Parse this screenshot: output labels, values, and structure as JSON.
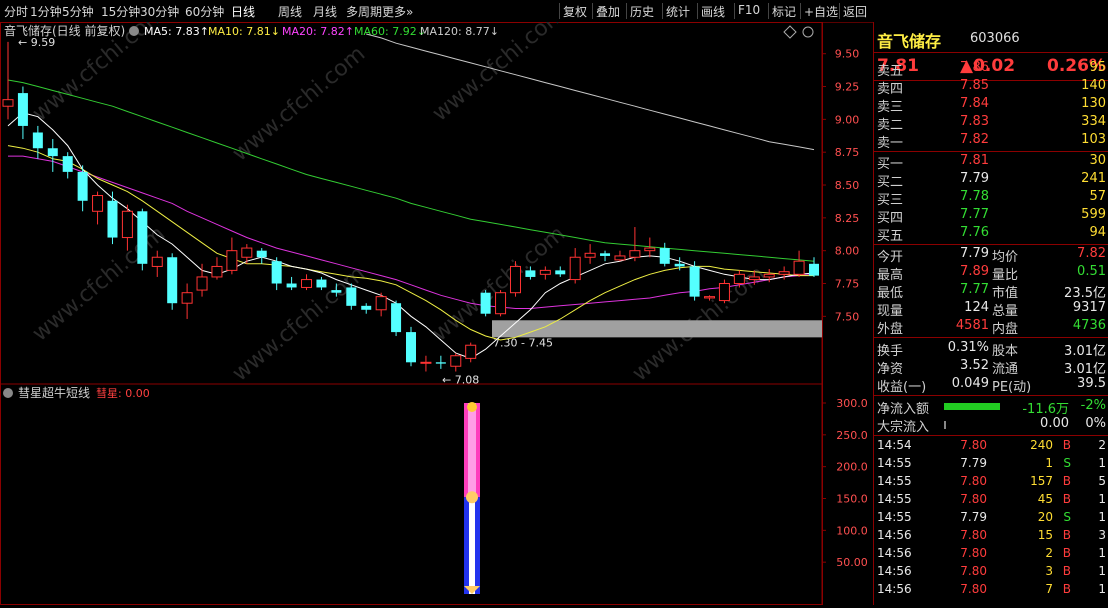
{
  "toolbar": {
    "tabs": [
      "分时",
      "1分钟",
      "5分钟",
      "15分钟",
      "30分钟",
      "60分钟",
      "日线",
      "周线",
      "月线",
      "多周期",
      "更多»"
    ],
    "active": "日线",
    "right_buttons": [
      "复权",
      "叠加",
      "历史",
      "统计",
      "画线",
      "F10",
      "标记",
      "+自选",
      "返回"
    ]
  },
  "main_chart": {
    "title": "音飞储存(日线 前复权)",
    "ma_labels": [
      {
        "text": "MA5: 7.83↑",
        "color": "#ffffff"
      },
      {
        "text": "MA10: 7.81↓",
        "color": "#ffee44"
      },
      {
        "text": "MA20: 7.82↑",
        "color": "#ff44ff"
      },
      {
        "text": "MA60: 7.92↓",
        "color": "#33dd33"
      },
      {
        "text": "MA120: 8.77↓",
        "color": "#cccccc"
      }
    ],
    "high_mark": "9.59",
    "low_mark": "7.08",
    "range_label": "7.30 - 7.45",
    "y_ticks": [
      "9.50",
      "9.25",
      "9.00",
      "8.75",
      "8.50",
      "8.25",
      "8.00",
      "7.75",
      "7.50"
    ]
  },
  "sub_chart": {
    "title": "彗星超牛短线",
    "indicator": "彗星: 0.00",
    "y_ticks": [
      "300.0",
      "250.0",
      "200.0",
      "150.0",
      "100.0",
      "50.00"
    ]
  },
  "chart_data": {
    "type": "candlestick",
    "y_range": [
      7.0,
      9.65
    ],
    "candles": [
      {
        "o": 9.1,
        "h": 9.59,
        "l": 9.0,
        "c": 9.15
      },
      {
        "o": 9.2,
        "h": 9.25,
        "l": 8.85,
        "c": 8.95
      },
      {
        "o": 8.9,
        "h": 8.95,
        "l": 8.7,
        "c": 8.78
      },
      {
        "o": 8.78,
        "h": 8.85,
        "l": 8.6,
        "c": 8.72
      },
      {
        "o": 8.72,
        "h": 8.75,
        "l": 8.55,
        "c": 8.6
      },
      {
        "o": 8.6,
        "h": 8.65,
        "l": 8.3,
        "c": 8.38
      },
      {
        "o": 8.3,
        "h": 8.45,
        "l": 8.2,
        "c": 8.42
      },
      {
        "o": 8.38,
        "h": 8.45,
        "l": 8.05,
        "c": 8.1
      },
      {
        "o": 8.1,
        "h": 8.35,
        "l": 8.0,
        "c": 8.3
      },
      {
        "o": 8.3,
        "h": 8.32,
        "l": 7.85,
        "c": 7.9
      },
      {
        "o": 7.88,
        "h": 8.0,
        "l": 7.8,
        "c": 7.95
      },
      {
        "o": 7.95,
        "h": 7.98,
        "l": 7.55,
        "c": 7.6
      },
      {
        "o": 7.6,
        "h": 7.75,
        "l": 7.48,
        "c": 7.68
      },
      {
        "o": 7.7,
        "h": 7.9,
        "l": 7.65,
        "c": 7.8
      },
      {
        "o": 7.8,
        "h": 7.95,
        "l": 7.78,
        "c": 7.88
      },
      {
        "o": 7.85,
        "h": 8.1,
        "l": 7.82,
        "c": 8.0
      },
      {
        "o": 7.95,
        "h": 8.05,
        "l": 7.9,
        "c": 8.02
      },
      {
        "o": 8.0,
        "h": 8.02,
        "l": 7.9,
        "c": 7.95
      },
      {
        "o": 7.92,
        "h": 7.95,
        "l": 7.7,
        "c": 7.75
      },
      {
        "o": 7.75,
        "h": 7.8,
        "l": 7.7,
        "c": 7.72
      },
      {
        "o": 7.72,
        "h": 7.82,
        "l": 7.7,
        "c": 7.78
      },
      {
        "o": 7.78,
        "h": 7.8,
        "l": 7.7,
        "c": 7.72
      },
      {
        "o": 7.7,
        "h": 7.75,
        "l": 7.65,
        "c": 7.68
      },
      {
        "o": 7.72,
        "h": 7.75,
        "l": 7.55,
        "c": 7.58
      },
      {
        "o": 7.58,
        "h": 7.6,
        "l": 7.52,
        "c": 7.55
      },
      {
        "o": 7.55,
        "h": 7.68,
        "l": 7.5,
        "c": 7.65
      },
      {
        "o": 7.6,
        "h": 7.62,
        "l": 7.35,
        "c": 7.38
      },
      {
        "o": 7.38,
        "h": 7.42,
        "l": 7.12,
        "c": 7.15
      },
      {
        "o": 7.15,
        "h": 7.2,
        "l": 7.08,
        "c": 7.15
      },
      {
        "o": 7.15,
        "h": 7.2,
        "l": 7.1,
        "c": 7.14
      },
      {
        "o": 7.12,
        "h": 7.22,
        "l": 7.08,
        "c": 7.2
      },
      {
        "o": 7.18,
        "h": 7.3,
        "l": 7.15,
        "c": 7.28
      },
      {
        "o": 7.68,
        "h": 7.7,
        "l": 7.5,
        "c": 7.52
      },
      {
        "o": 7.52,
        "h": 7.7,
        "l": 7.5,
        "c": 7.68
      },
      {
        "o": 7.68,
        "h": 7.92,
        "l": 7.65,
        "c": 7.88
      },
      {
        "o": 7.85,
        "h": 7.88,
        "l": 7.78,
        "c": 7.8
      },
      {
        "o": 7.82,
        "h": 7.88,
        "l": 7.78,
        "c": 7.85
      },
      {
        "o": 7.85,
        "h": 7.88,
        "l": 7.8,
        "c": 7.82
      },
      {
        "o": 7.78,
        "h": 8.02,
        "l": 7.75,
        "c": 7.95
      },
      {
        "o": 7.95,
        "h": 8.05,
        "l": 7.9,
        "c": 7.98
      },
      {
        "o": 7.98,
        "h": 8.0,
        "l": 7.92,
        "c": 7.96
      },
      {
        "o": 7.93,
        "h": 8.0,
        "l": 7.92,
        "c": 7.96
      },
      {
        "o": 7.95,
        "h": 8.18,
        "l": 7.92,
        "c": 8.0
      },
      {
        "o": 8.0,
        "h": 8.1,
        "l": 7.95,
        "c": 8.02
      },
      {
        "o": 8.02,
        "h": 8.06,
        "l": 7.88,
        "c": 7.9
      },
      {
        "o": 7.9,
        "h": 7.95,
        "l": 7.85,
        "c": 7.88
      },
      {
        "o": 7.88,
        "h": 7.92,
        "l": 7.62,
        "c": 7.65
      },
      {
        "o": 7.64,
        "h": 7.66,
        "l": 7.62,
        "c": 7.65
      },
      {
        "o": 7.62,
        "h": 7.78,
        "l": 7.6,
        "c": 7.75
      },
      {
        "o": 7.75,
        "h": 7.85,
        "l": 7.72,
        "c": 7.82
      },
      {
        "o": 7.78,
        "h": 7.85,
        "l": 7.74,
        "c": 7.8
      },
      {
        "o": 7.8,
        "h": 7.86,
        "l": 7.76,
        "c": 7.82
      },
      {
        "o": 7.82,
        "h": 7.88,
        "l": 7.78,
        "c": 7.84
      },
      {
        "o": 7.82,
        "h": 8.0,
        "l": 7.8,
        "c": 7.92
      },
      {
        "o": 7.9,
        "h": 7.95,
        "l": 7.8,
        "c": 7.81
      }
    ],
    "ma5": [
      8.95,
      9.05,
      9.02,
      8.92,
      8.8,
      8.62,
      8.5,
      8.4,
      8.32,
      8.22,
      8.12,
      8.05,
      7.95,
      7.85,
      7.82,
      7.86,
      7.92,
      7.95,
      7.92,
      7.88,
      7.86,
      7.83,
      7.78,
      7.74,
      7.7,
      7.66,
      7.6,
      7.5,
      7.42,
      7.32,
      7.22,
      7.18,
      7.25,
      7.35,
      7.45,
      7.55,
      7.68,
      7.75,
      7.8,
      7.85,
      7.9,
      7.92,
      7.95,
      7.96,
      7.95,
      7.92,
      7.88,
      7.85,
      7.82,
      7.8,
      7.78,
      7.78,
      7.8,
      7.82,
      7.83
    ],
    "ma10": [
      8.8,
      8.78,
      8.75,
      8.7,
      8.68,
      8.62,
      8.55,
      8.5,
      8.45,
      8.38,
      8.3,
      8.22,
      8.14,
      8.06,
      7.98,
      7.94,
      7.9,
      7.9,
      7.89,
      7.88,
      7.86,
      7.84,
      7.82,
      7.8,
      7.79,
      7.77,
      7.74,
      7.68,
      7.62,
      7.55,
      7.47,
      7.4,
      7.35,
      7.32,
      7.34,
      7.38,
      7.42,
      7.48,
      7.55,
      7.62,
      7.68,
      7.73,
      7.78,
      7.82,
      7.85,
      7.87,
      7.88,
      7.88,
      7.86,
      7.85,
      7.84,
      7.83,
      7.82,
      7.81,
      7.81
    ],
    "ma20": [
      8.72,
      8.72,
      8.7,
      8.68,
      8.64,
      8.6,
      8.56,
      8.52,
      8.48,
      8.44,
      8.4,
      8.36,
      8.3,
      8.25,
      8.2,
      8.15,
      8.1,
      8.06,
      8.02,
      7.99,
      7.96,
      7.93,
      7.9,
      7.87,
      7.84,
      7.81,
      7.78,
      7.74,
      7.7,
      7.66,
      7.63,
      7.6,
      7.58,
      7.57,
      7.56,
      7.56,
      7.57,
      7.58,
      7.59,
      7.6,
      7.61,
      7.62,
      7.63,
      7.64,
      7.66,
      7.68,
      7.69,
      7.71,
      7.72,
      7.74,
      7.76,
      7.78,
      7.8,
      7.81,
      7.82
    ],
    "ma60": [
      9.3,
      9.28,
      9.25,
      9.22,
      9.19,
      9.16,
      9.13,
      9.1,
      9.06,
      9.02,
      8.98,
      8.94,
      8.9,
      8.86,
      8.82,
      8.78,
      8.74,
      8.7,
      8.66,
      8.62,
      8.58,
      8.55,
      8.52,
      8.49,
      8.46,
      8.43,
      8.4,
      8.36,
      8.33,
      8.3,
      8.27,
      8.24,
      8.22,
      8.2,
      8.18,
      8.16,
      8.14,
      8.12,
      8.1,
      8.08,
      8.06,
      8.05,
      8.04,
      8.03,
      8.02,
      8.01,
      8.0,
      7.99,
      7.98,
      7.97,
      7.96,
      7.95,
      7.94,
      7.93,
      7.92
    ],
    "ma120": [
      null,
      null,
      null,
      null,
      null,
      null,
      null,
      null,
      null,
      null,
      null,
      null,
      null,
      null,
      null,
      null,
      null,
      null,
      null,
      null,
      null,
      null,
      null,
      null,
      9.65,
      9.62,
      9.58,
      9.55,
      9.52,
      9.49,
      9.46,
      9.43,
      9.4,
      9.37,
      9.34,
      9.31,
      9.28,
      9.25,
      9.22,
      9.19,
      9.16,
      9.13,
      9.1,
      9.07,
      9.04,
      9.01,
      8.98,
      8.95,
      8.92,
      8.89,
      8.86,
      8.83,
      8.81,
      8.79,
      8.77
    ],
    "sub_bar": {
      "top_value": 300,
      "mid_value": 152,
      "bottom_value": 0
    }
  },
  "quote": {
    "name": "音飞储存",
    "code": "603066",
    "price": "7.81",
    "change": "▲0.02",
    "pct": "0.26%",
    "asks": [
      {
        "label": "卖五",
        "price": "7.86",
        "vol": "95",
        "pc": "red"
      },
      {
        "label": "卖四",
        "price": "7.85",
        "vol": "140",
        "pc": "red"
      },
      {
        "label": "卖三",
        "price": "7.84",
        "vol": "130",
        "pc": "red"
      },
      {
        "label": "卖二",
        "price": "7.83",
        "vol": "334",
        "pc": "red"
      },
      {
        "label": "卖一",
        "price": "7.82",
        "vol": "103",
        "pc": "red"
      }
    ],
    "bids": [
      {
        "label": "买一",
        "price": "7.81",
        "vol": "30",
        "pc": "red"
      },
      {
        "label": "买二",
        "price": "7.79",
        "vol": "241",
        "pc": "white"
      },
      {
        "label": "买三",
        "price": "7.78",
        "vol": "57",
        "pc": "green"
      },
      {
        "label": "买四",
        "price": "7.77",
        "vol": "599",
        "pc": "green"
      },
      {
        "label": "买五",
        "price": "7.76",
        "vol": "94",
        "pc": "green"
      }
    ],
    "stats": [
      {
        "k1": "今开",
        "v1": "7.79",
        "c1": "white",
        "k2": "均价",
        "v2": "7.82",
        "c2": "red"
      },
      {
        "k1": "最高",
        "v1": "7.89",
        "c1": "red",
        "k2": "量比",
        "v2": "0.51",
        "c2": "green"
      },
      {
        "k1": "最低",
        "v1": "7.77",
        "c1": "green",
        "k2": "市值",
        "v2": "23.5亿",
        "c2": "white"
      },
      {
        "k1": "现量",
        "v1": "124",
        "c1": "white",
        "k2": "总量",
        "v2": "9317",
        "c2": "white"
      },
      {
        "k1": "外盘",
        "v1": "4581",
        "c1": "red",
        "k2": "内盘",
        "v2": "4736",
        "c2": "green"
      }
    ],
    "fund": [
      {
        "k1": "换手",
        "v1": "0.31%",
        "k2": "股本",
        "v2": "3.01亿"
      },
      {
        "k1": "净资",
        "v1": "3.52",
        "k2": "流通",
        "v2": "3.01亿"
      },
      {
        "k1": "收益(一)",
        "v1": "0.049",
        "k2": "PE(动)",
        "v2": "39.5"
      }
    ],
    "flow": {
      "label": "净流入额",
      "value": "-11.6万",
      "pct": "-2%",
      "bulk_label": "大宗流入",
      "bulk_value": "0.00",
      "bulk_pct": "0%"
    },
    "ticks": [
      {
        "t": "14:54",
        "p": "7.80",
        "pc": "red",
        "v": "240",
        "vc": "yellow",
        "s": "B",
        "sc": "red",
        "n": "2"
      },
      {
        "t": "14:55",
        "p": "7.79",
        "pc": "white",
        "v": "1",
        "vc": "yellow",
        "s": "S",
        "sc": "green",
        "n": "1"
      },
      {
        "t": "14:55",
        "p": "7.80",
        "pc": "red",
        "v": "157",
        "vc": "yellow",
        "s": "B",
        "sc": "red",
        "n": "5"
      },
      {
        "t": "14:55",
        "p": "7.80",
        "pc": "red",
        "v": "45",
        "vc": "yellow",
        "s": "B",
        "sc": "red",
        "n": "1"
      },
      {
        "t": "14:55",
        "p": "7.79",
        "pc": "white",
        "v": "20",
        "vc": "yellow",
        "s": "S",
        "sc": "green",
        "n": "1"
      },
      {
        "t": "14:56",
        "p": "7.80",
        "pc": "red",
        "v": "15",
        "vc": "yellow",
        "s": "B",
        "sc": "red",
        "n": "3"
      },
      {
        "t": "14:56",
        "p": "7.80",
        "pc": "red",
        "v": "2",
        "vc": "yellow",
        "s": "B",
        "sc": "red",
        "n": "1"
      },
      {
        "t": "14:56",
        "p": "7.80",
        "pc": "red",
        "v": "3",
        "vc": "yellow",
        "s": "B",
        "sc": "red",
        "n": "1"
      },
      {
        "t": "14:56",
        "p": "7.80",
        "pc": "red",
        "v": "7",
        "vc": "yellow",
        "s": "B",
        "sc": "red",
        "n": "1"
      }
    ]
  },
  "watermark": "www.cfchi.com"
}
